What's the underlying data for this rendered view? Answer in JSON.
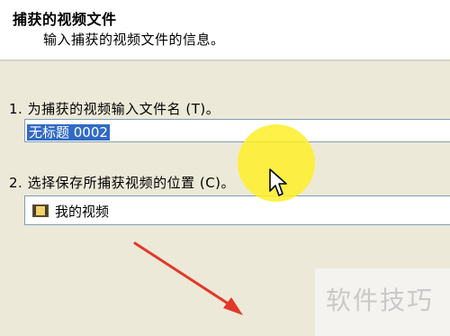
{
  "header": {
    "title": "捕获的视频文件",
    "subtitle": "输入捕获的视频文件的信息。"
  },
  "step1": {
    "label": "1. 为捕获的视频输入文件名 (T)。",
    "filename_value": "无标题 0002"
  },
  "step2": {
    "label": "2. 选择保存所捕获视频的位置 (C)。",
    "location_value": "我的视频"
  },
  "overlay": {
    "highlight_color": "#fff028",
    "arrow_color": "#e0392b"
  },
  "watermark": "软件技巧"
}
